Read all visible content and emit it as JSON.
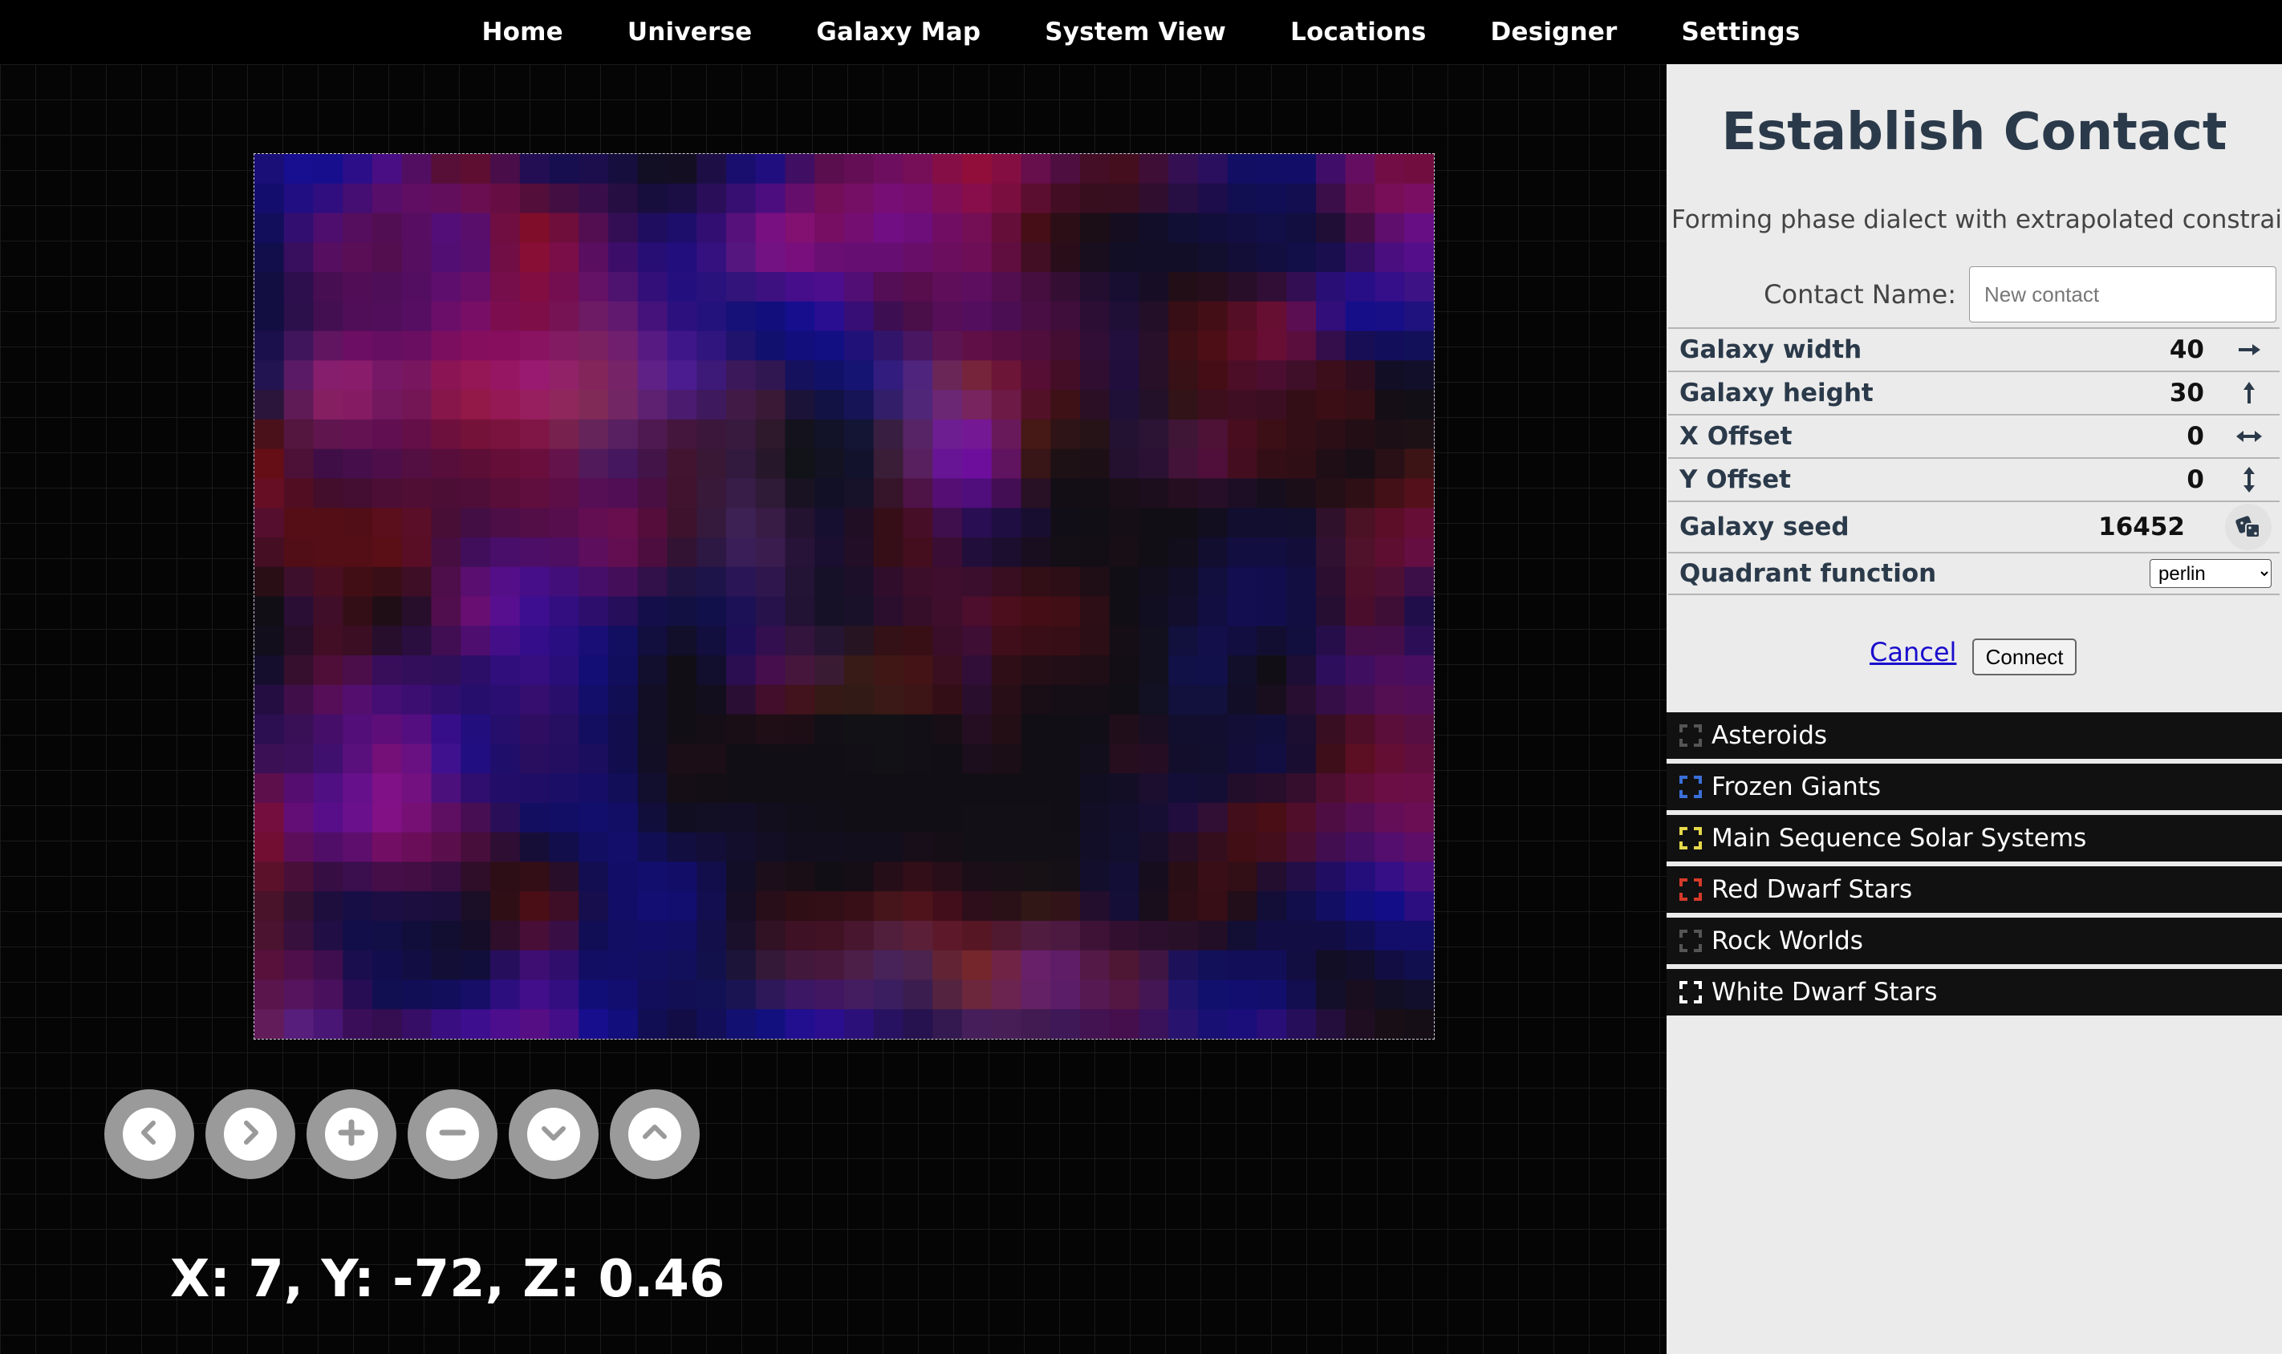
{
  "nav": {
    "items": [
      {
        "label": "Home"
      },
      {
        "label": "Universe"
      },
      {
        "label": "Galaxy Map"
      },
      {
        "label": "System View"
      },
      {
        "label": "Locations"
      },
      {
        "label": "Designer"
      },
      {
        "label": "Settings"
      }
    ]
  },
  "map": {
    "grid_cols": 40,
    "grid_rows": 30,
    "controls": [
      {
        "icon": "chevron-left-icon"
      },
      {
        "icon": "chevron-right-icon"
      },
      {
        "icon": "zoom-in-icon"
      },
      {
        "icon": "zoom-out-icon"
      },
      {
        "icon": "chevron-down-icon"
      },
      {
        "icon": "chevron-up-icon"
      }
    ],
    "coordinates": "X: 7, Y: -72, Z: 0.46"
  },
  "panel": {
    "title": "Establish Contact",
    "subtitle": "Forming phase dialect with extrapolated constraints:",
    "contact_label": "Contact Name:",
    "contact_placeholder": "New contact",
    "contact_value": "",
    "params": {
      "width": {
        "label": "Galaxy width",
        "value": "40",
        "icon": "arrow-right-icon"
      },
      "height": {
        "label": "Galaxy height",
        "value": "30",
        "icon": "arrow-up-icon"
      },
      "x_offset": {
        "label": "X Offset",
        "value": "0",
        "icon": "arrow-left-right-icon"
      },
      "y_offset": {
        "label": "Y Offset",
        "value": "0",
        "icon": "arrow-up-down-icon"
      },
      "seed": {
        "label": "Galaxy seed",
        "value": "16452",
        "icon": "dice-icon"
      },
      "quadrant": {
        "label": "Quadrant function",
        "selected": "perlin"
      }
    },
    "cancel_label": "Cancel",
    "connect_label": "Connect",
    "categories": [
      {
        "label": "Asteroids",
        "color": "#555555"
      },
      {
        "label": "Frozen Giants",
        "color": "#3a6fd8"
      },
      {
        "label": "Main Sequence Solar Systems",
        "color": "#e6d94a"
      },
      {
        "label": "Red Dwarf Stars",
        "color": "#d63a2a"
      },
      {
        "label": "Rock Worlds",
        "color": "#555555"
      },
      {
        "label": "White Dwarf Stars",
        "color": "#ffffff"
      }
    ]
  }
}
